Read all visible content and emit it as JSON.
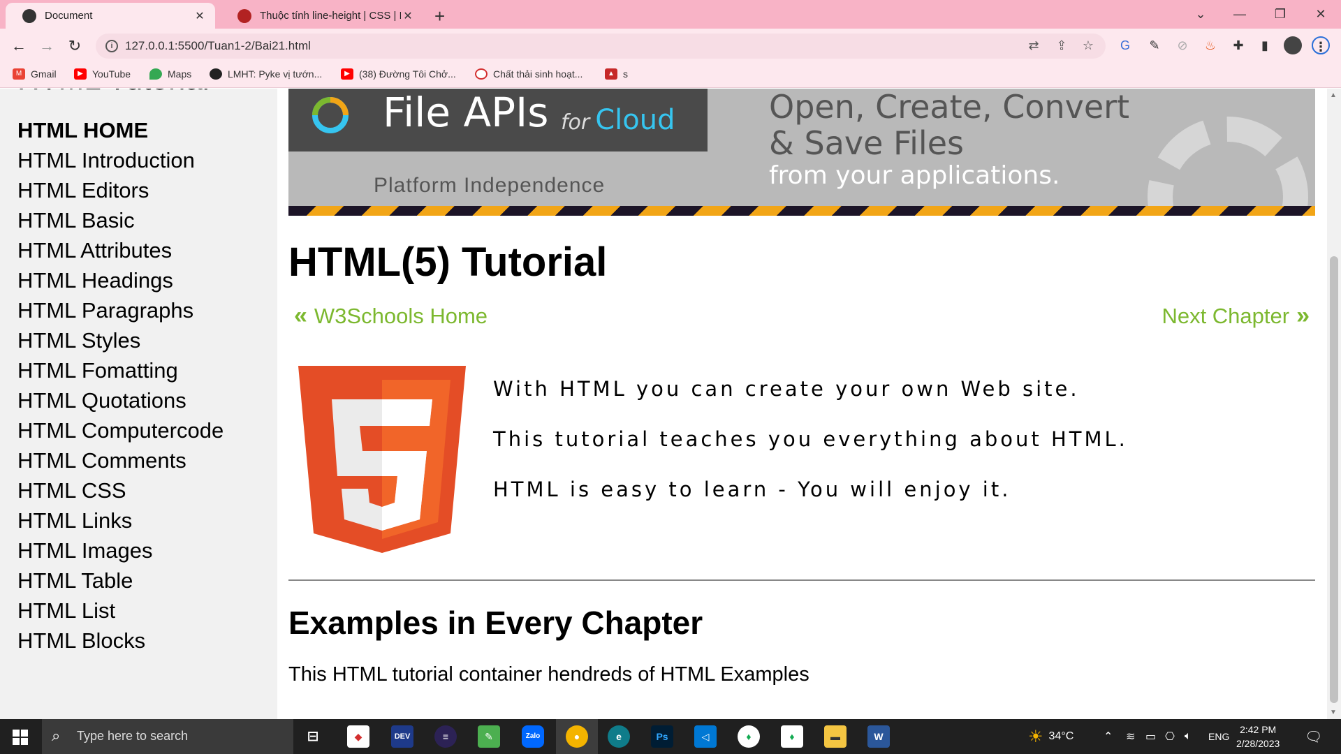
{
  "browser": {
    "tabs": [
      {
        "title": "Document",
        "active": true
      },
      {
        "title": "Thuộc tính line-height | CSS | Ho",
        "active": false
      }
    ],
    "new_tab": "+",
    "url": "127.0.0.1:5500/Tuan1-2/Bai21.html",
    "bookmarks": [
      "Gmail",
      "YouTube",
      "Maps",
      "LMHT: Pyke vị tướn...",
      "(38) Đường Tôi Chở...",
      "Chất thải sinh hoạt...",
      "s"
    ]
  },
  "sidebar": {
    "title": "HTML Tutorial",
    "items": [
      "HTML HOME",
      "HTML Introduction",
      "HTML Editors",
      "HTML Basic",
      "HTML Attributes",
      "HTML Headings",
      "HTML Paragraphs",
      "HTML Styles",
      "HTML Fomatting",
      "HTML Quotations",
      "HTML Computercode",
      "HTML Comments",
      "HTML CSS",
      "HTML Links",
      "HTML Images",
      "HTML Table",
      "HTML List",
      "HTML Blocks"
    ]
  },
  "banner": {
    "title": "File APIs",
    "for": "for",
    "cloud": "Cloud",
    "subtitle": "Platform Independence",
    "tagline1": "Open, Create, Convert",
    "tagline2": "& Save Files",
    "tagline3": "from your applications."
  },
  "main": {
    "heading": "HTML(5) Tutorial",
    "prev_link": "W3Schools Home",
    "next_link": "Next Chapter",
    "intro": [
      "With HTML you can create your own Web site.",
      "This tutorial teaches you everything about HTML.",
      "HTML is easy to learn - You will enjoy it."
    ],
    "section_heading": "Examples in Every Chapter",
    "section_text": "This HTML tutorial container hendreds of HTML Examples"
  },
  "taskbar": {
    "search_placeholder": "Type here to search",
    "weather": "34°C",
    "language": "ENG",
    "time": "2:42 PM",
    "date": "2/28/2023"
  },
  "colors": {
    "tab_bar": "#f8b3c6",
    "toolbar": "#fde8ee",
    "link_green": "#7cb82f",
    "html5_orange": "#e44d26"
  }
}
